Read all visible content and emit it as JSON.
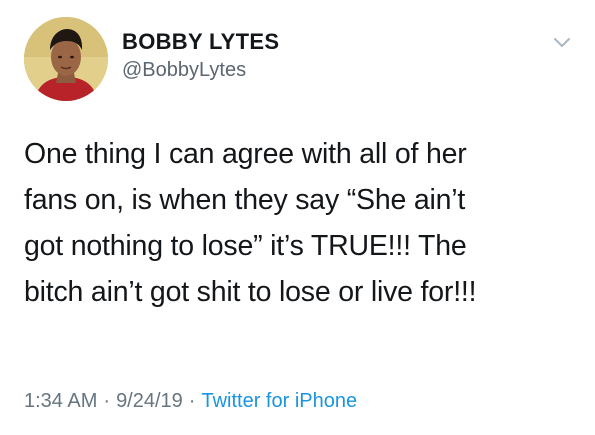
{
  "tweet": {
    "display_name": "BOBBY LYTES",
    "handle": "@BobbyLytes",
    "text": "One thing I can agree with all of her\nfans on, is when they say “She ain’t\ngot nothing to lose” it’s TRUE!!! The\nbitch ain’t got shit to lose or live for!!!",
    "time": "1:34 AM",
    "date": "9/24/19",
    "separator": "·",
    "source": "Twitter for iPhone"
  },
  "icons": {
    "menu": "chevron-down-icon",
    "avatar": "profile-photo"
  },
  "colors": {
    "text": "#14171a",
    "secondary": "#66757f",
    "link": "#1b95e0"
  }
}
